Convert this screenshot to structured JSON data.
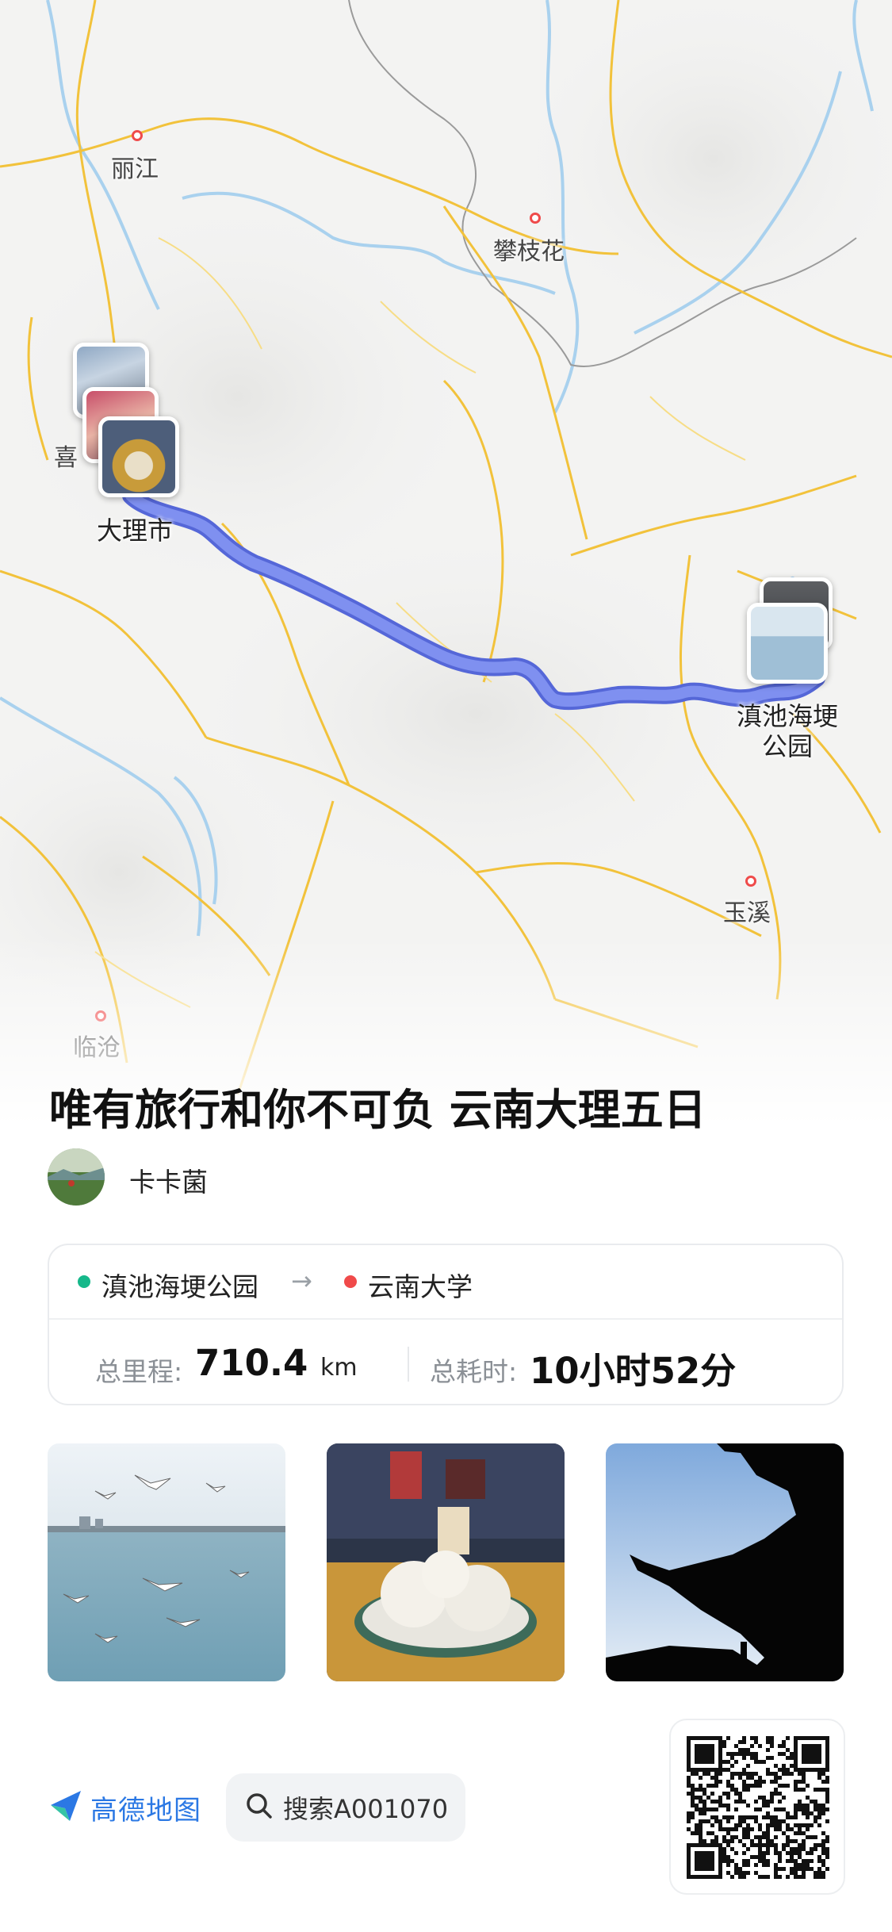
{
  "map": {
    "cities": [
      {
        "name": "丽江"
      },
      {
        "name": "攀枝花"
      },
      {
        "name": "喜"
      },
      {
        "name": "大理市"
      },
      {
        "name": "玉溪"
      },
      {
        "name": "临沧"
      }
    ],
    "poi_end": {
      "line1": "滇池海埂",
      "line2": "公园"
    },
    "colors": {
      "route": "#6f82ee",
      "road": "#f2c23b",
      "river": "#a9d1ee",
      "border": "#9a9a9a"
    }
  },
  "trip": {
    "title": "唯有旅行和你不可负 云南大理五日",
    "author": "卡卡菌"
  },
  "route": {
    "from": "滇池海埂公园",
    "to": "云南大学",
    "arrow": "→",
    "distance_label": "总里程:",
    "distance_value": "710.4",
    "distance_unit": "km",
    "duration_label": "总耗时:",
    "duration_value": "10小时52分",
    "from_color": "#16b88a",
    "to_color": "#f04a4a"
  },
  "photos": [
    {
      "icon": "seagull-lake-photo"
    },
    {
      "icon": "steamed-buns-photo"
    },
    {
      "icon": "temple-roof-silhouette-photo"
    }
  ],
  "footer": {
    "brand": "高德地图",
    "search_text": "搜索A001070",
    "brand_color": "#2b78e4"
  }
}
